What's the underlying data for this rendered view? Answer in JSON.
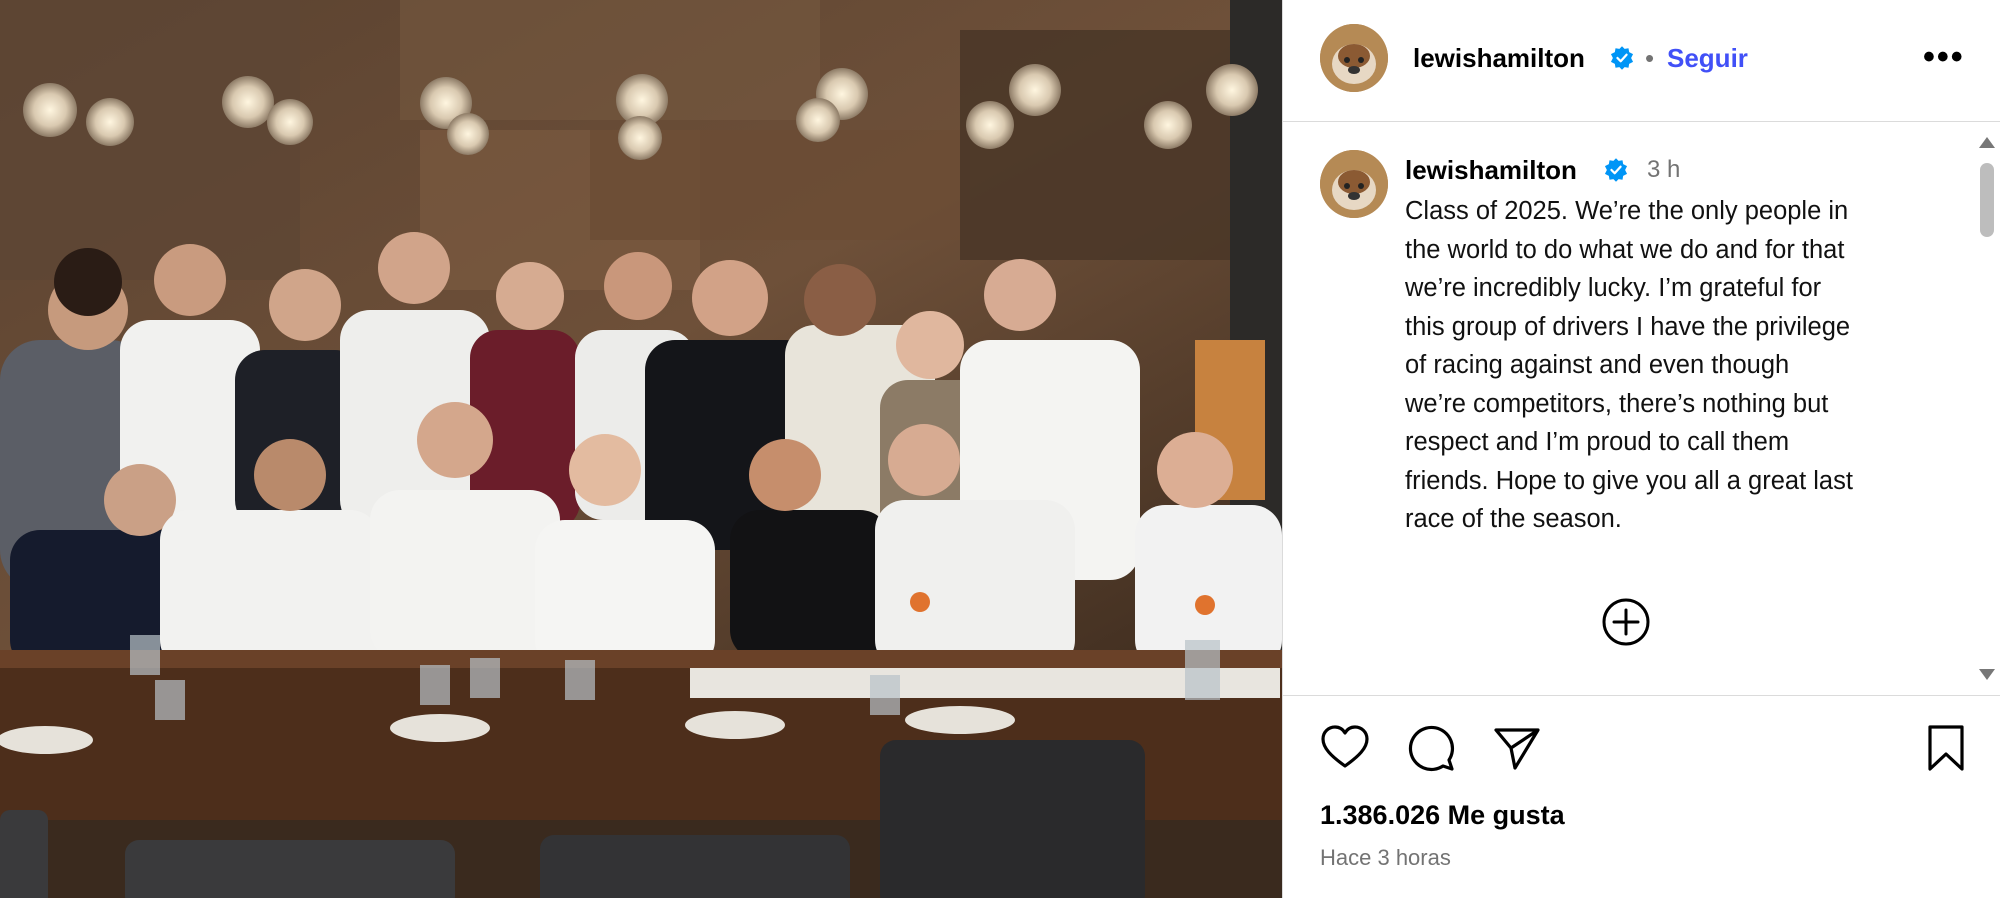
{
  "photo": {
    "description_icon": "group-photo"
  },
  "post": {
    "username": "lewishamilton",
    "verified": true,
    "separator": "•",
    "follow_label": "Seguir",
    "more_label": "•••",
    "time": "3 h",
    "caption": [
      "Class of 2025. We’re the only people in",
      "the world to do what we do and for that",
      "we’re incredibly lucky. I’m grateful for",
      "this group of drivers I have the privilege",
      "of racing against and even though",
      "we’re competitors, there’s nothing but",
      "respect and I’m proud to call them",
      "friends. Hope to give you all a great last",
      "race of the season."
    ],
    "likes": "1.386.026 Me gusta",
    "ago": "Hace 3 horas"
  },
  "colors": {
    "accent": "#4150f7",
    "verified": "#0095f6",
    "muted": "#737373",
    "border": "#dbdbdb"
  },
  "icons": {
    "like": "heart-icon",
    "comment": "comment-icon",
    "share": "send-icon",
    "save": "bookmark-icon",
    "add": "plus-circle-icon",
    "verified": "verified-badge-icon"
  }
}
